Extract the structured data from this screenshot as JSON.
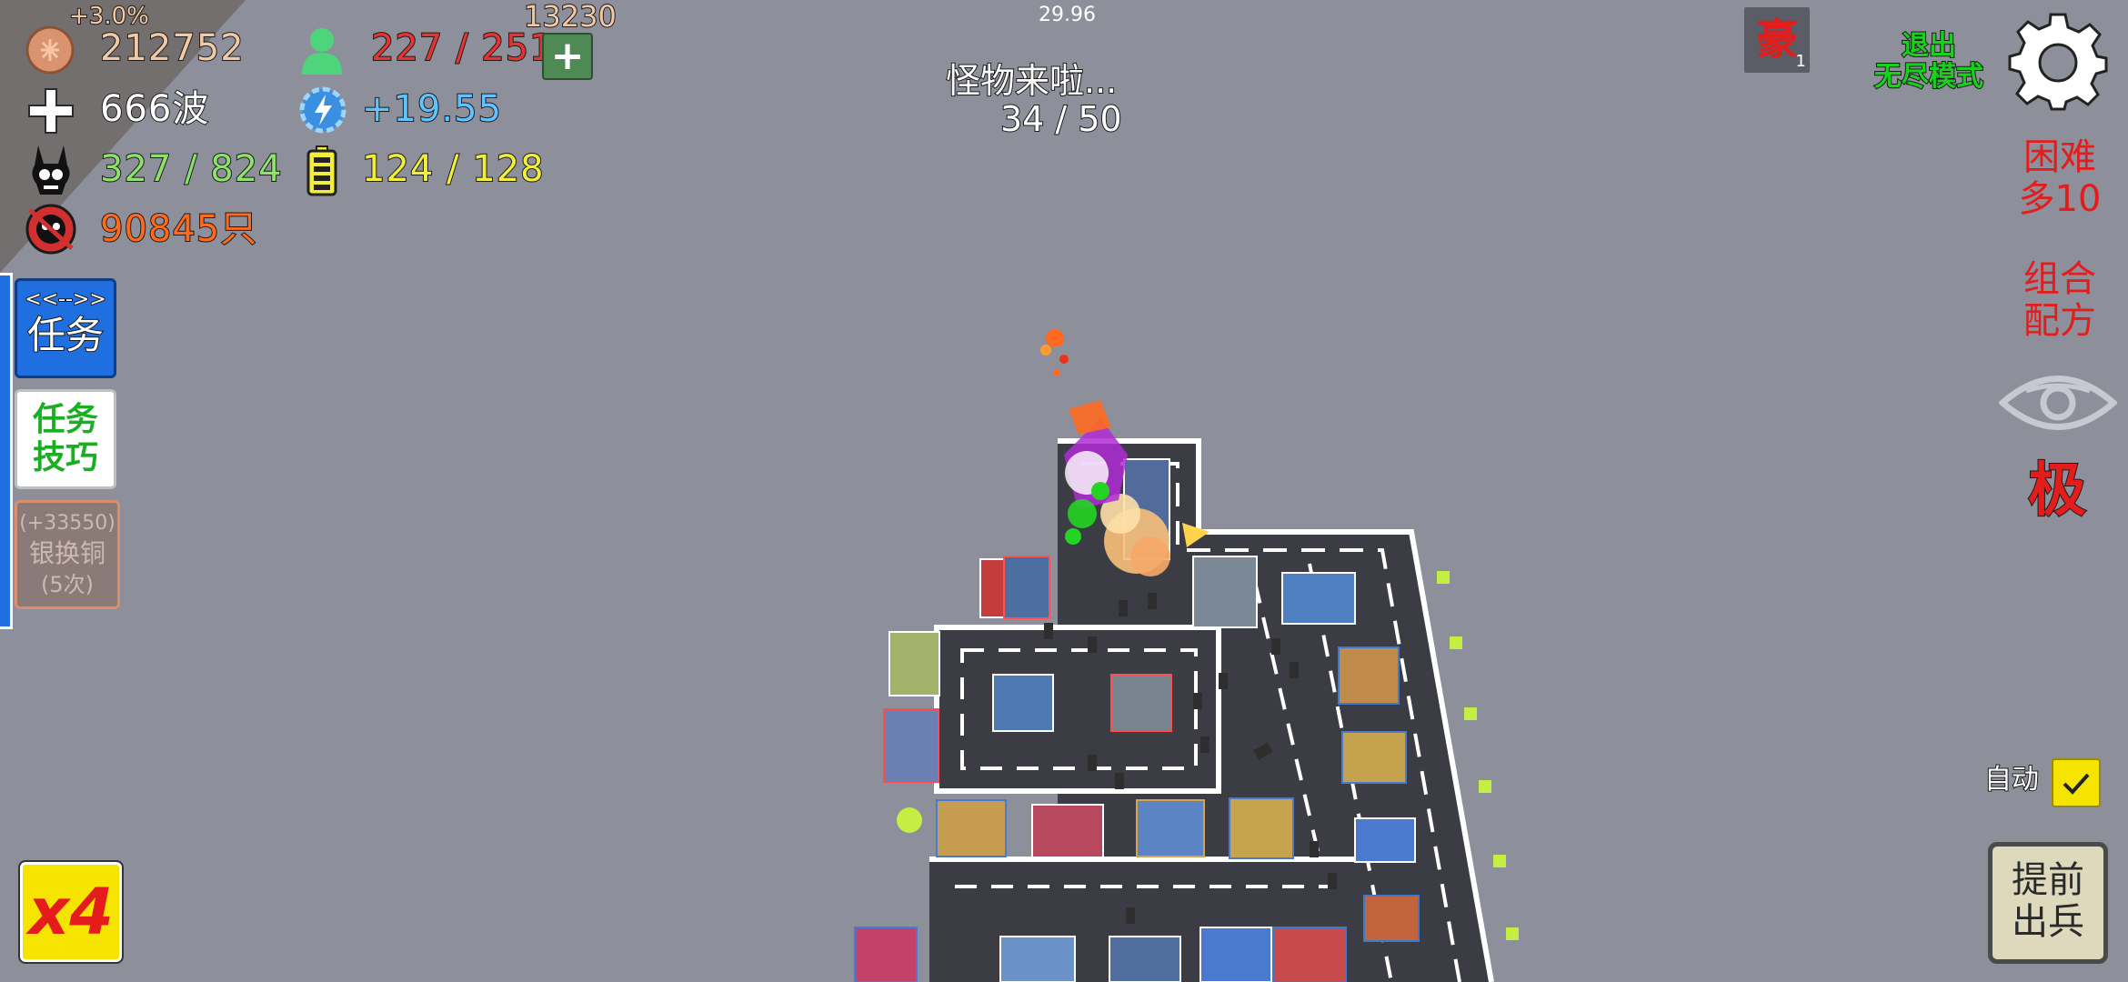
{
  "fps": "29.96",
  "resources": {
    "copper_percent": "+3.0%",
    "copper": "212752",
    "wave": "666波",
    "kills": "327 / 824",
    "total_monsters": "90845只",
    "population": "227 / 251",
    "population_top": "13230",
    "population_add": "+",
    "energy_rate": "+19.55",
    "battery": "124 / 128"
  },
  "wave_status": {
    "title": "怪物来啦...",
    "progress": "34 / 50"
  },
  "left_panel": {
    "task_arrows": "<<-->>",
    "task_label": "任务",
    "tips_line1": "任务",
    "tips_line2": "技巧",
    "exchange_line1": "(+33550)",
    "exchange_line2": "银换铜",
    "exchange_line3": "(5次)"
  },
  "speed_label": "x4",
  "right_panel": {
    "badge_glyph": "豪",
    "badge_count": "1",
    "exit_line1": "退出",
    "exit_line2": "无尽模式",
    "difficulty_line1": "困难",
    "difficulty_line2": "多10",
    "recipe_line1": "组合",
    "recipe_line2": "配方",
    "quality_label": "极",
    "auto_label": "自动",
    "auto_checked": true,
    "early_line1": "提前",
    "early_line2": "出兵"
  },
  "colors": {
    "background": "#8d8f9a",
    "road": "#3c3d44",
    "road_lines": "#ffffff",
    "copper_text": "#f1c9a6",
    "kills_text": "#8ee26c",
    "monsters_text": "#ff6a1a",
    "pop_text": "#e53434",
    "energy_text": "#5fc3ff",
    "battery_text": "#f2ee3a",
    "task_button": "#1f6fe0",
    "exit_text": "#19d01c",
    "danger_text": "#e31c1c",
    "speed_bg": "#f5e400"
  },
  "icons": {
    "copper": "copper-coin-icon",
    "wave": "plus-cross-icon",
    "kills": "skull-bunny-icon",
    "monsters": "monster-head-icon",
    "population": "person-icon",
    "energy": "lightning-icon",
    "battery": "battery-icon",
    "settings": "gear-icon",
    "view": "eye-icon",
    "auto": "check-icon"
  }
}
